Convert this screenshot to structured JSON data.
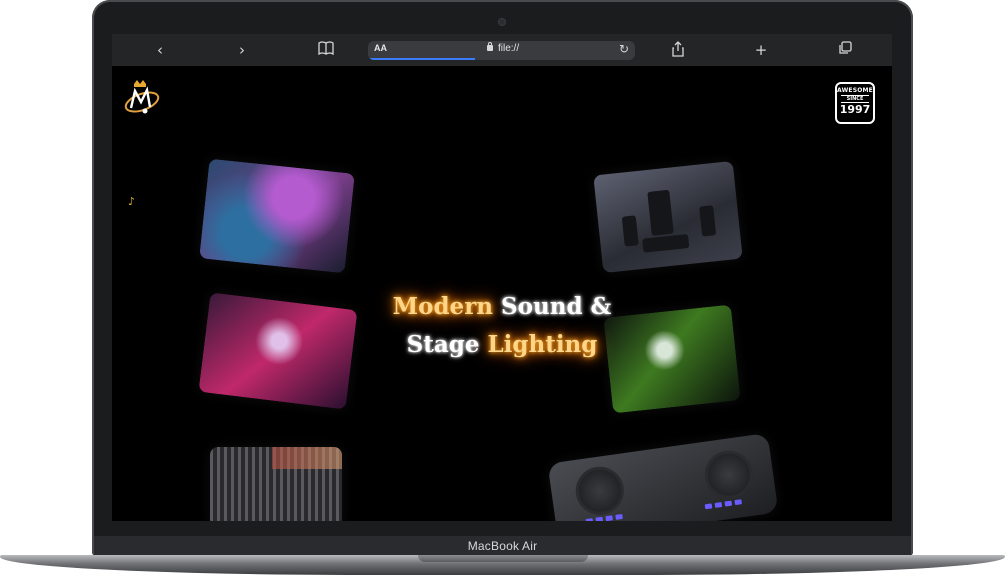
{
  "device": {
    "label": "MacBook Air"
  },
  "browser": {
    "url": "file://",
    "reader_label": "AA",
    "icons": {
      "back": "chevron-left-icon",
      "forward": "chevron-right-icon",
      "bookmarks": "book-icon",
      "reload": "reload-icon",
      "share": "share-icon",
      "new_tab": "plus-icon",
      "tabs": "tabs-icon"
    },
    "load_progress": 0.4
  },
  "page": {
    "badge": {
      "top": "AWESOME",
      "middle": "SINCE",
      "year": "1997"
    },
    "headline": {
      "line1": [
        {
          "text": "Modern",
          "style": "orange"
        },
        {
          "text": "Sound",
          "style": "white"
        },
        {
          "text": "&",
          "style": "white"
        }
      ],
      "line2": [
        {
          "text": "Stage",
          "style": "white"
        },
        {
          "text": "Lighting",
          "style": "orange"
        }
      ]
    },
    "music_note": "♪",
    "colors": {
      "glow": "#ff8a00",
      "accent_text": "#ffd58a"
    }
  }
}
